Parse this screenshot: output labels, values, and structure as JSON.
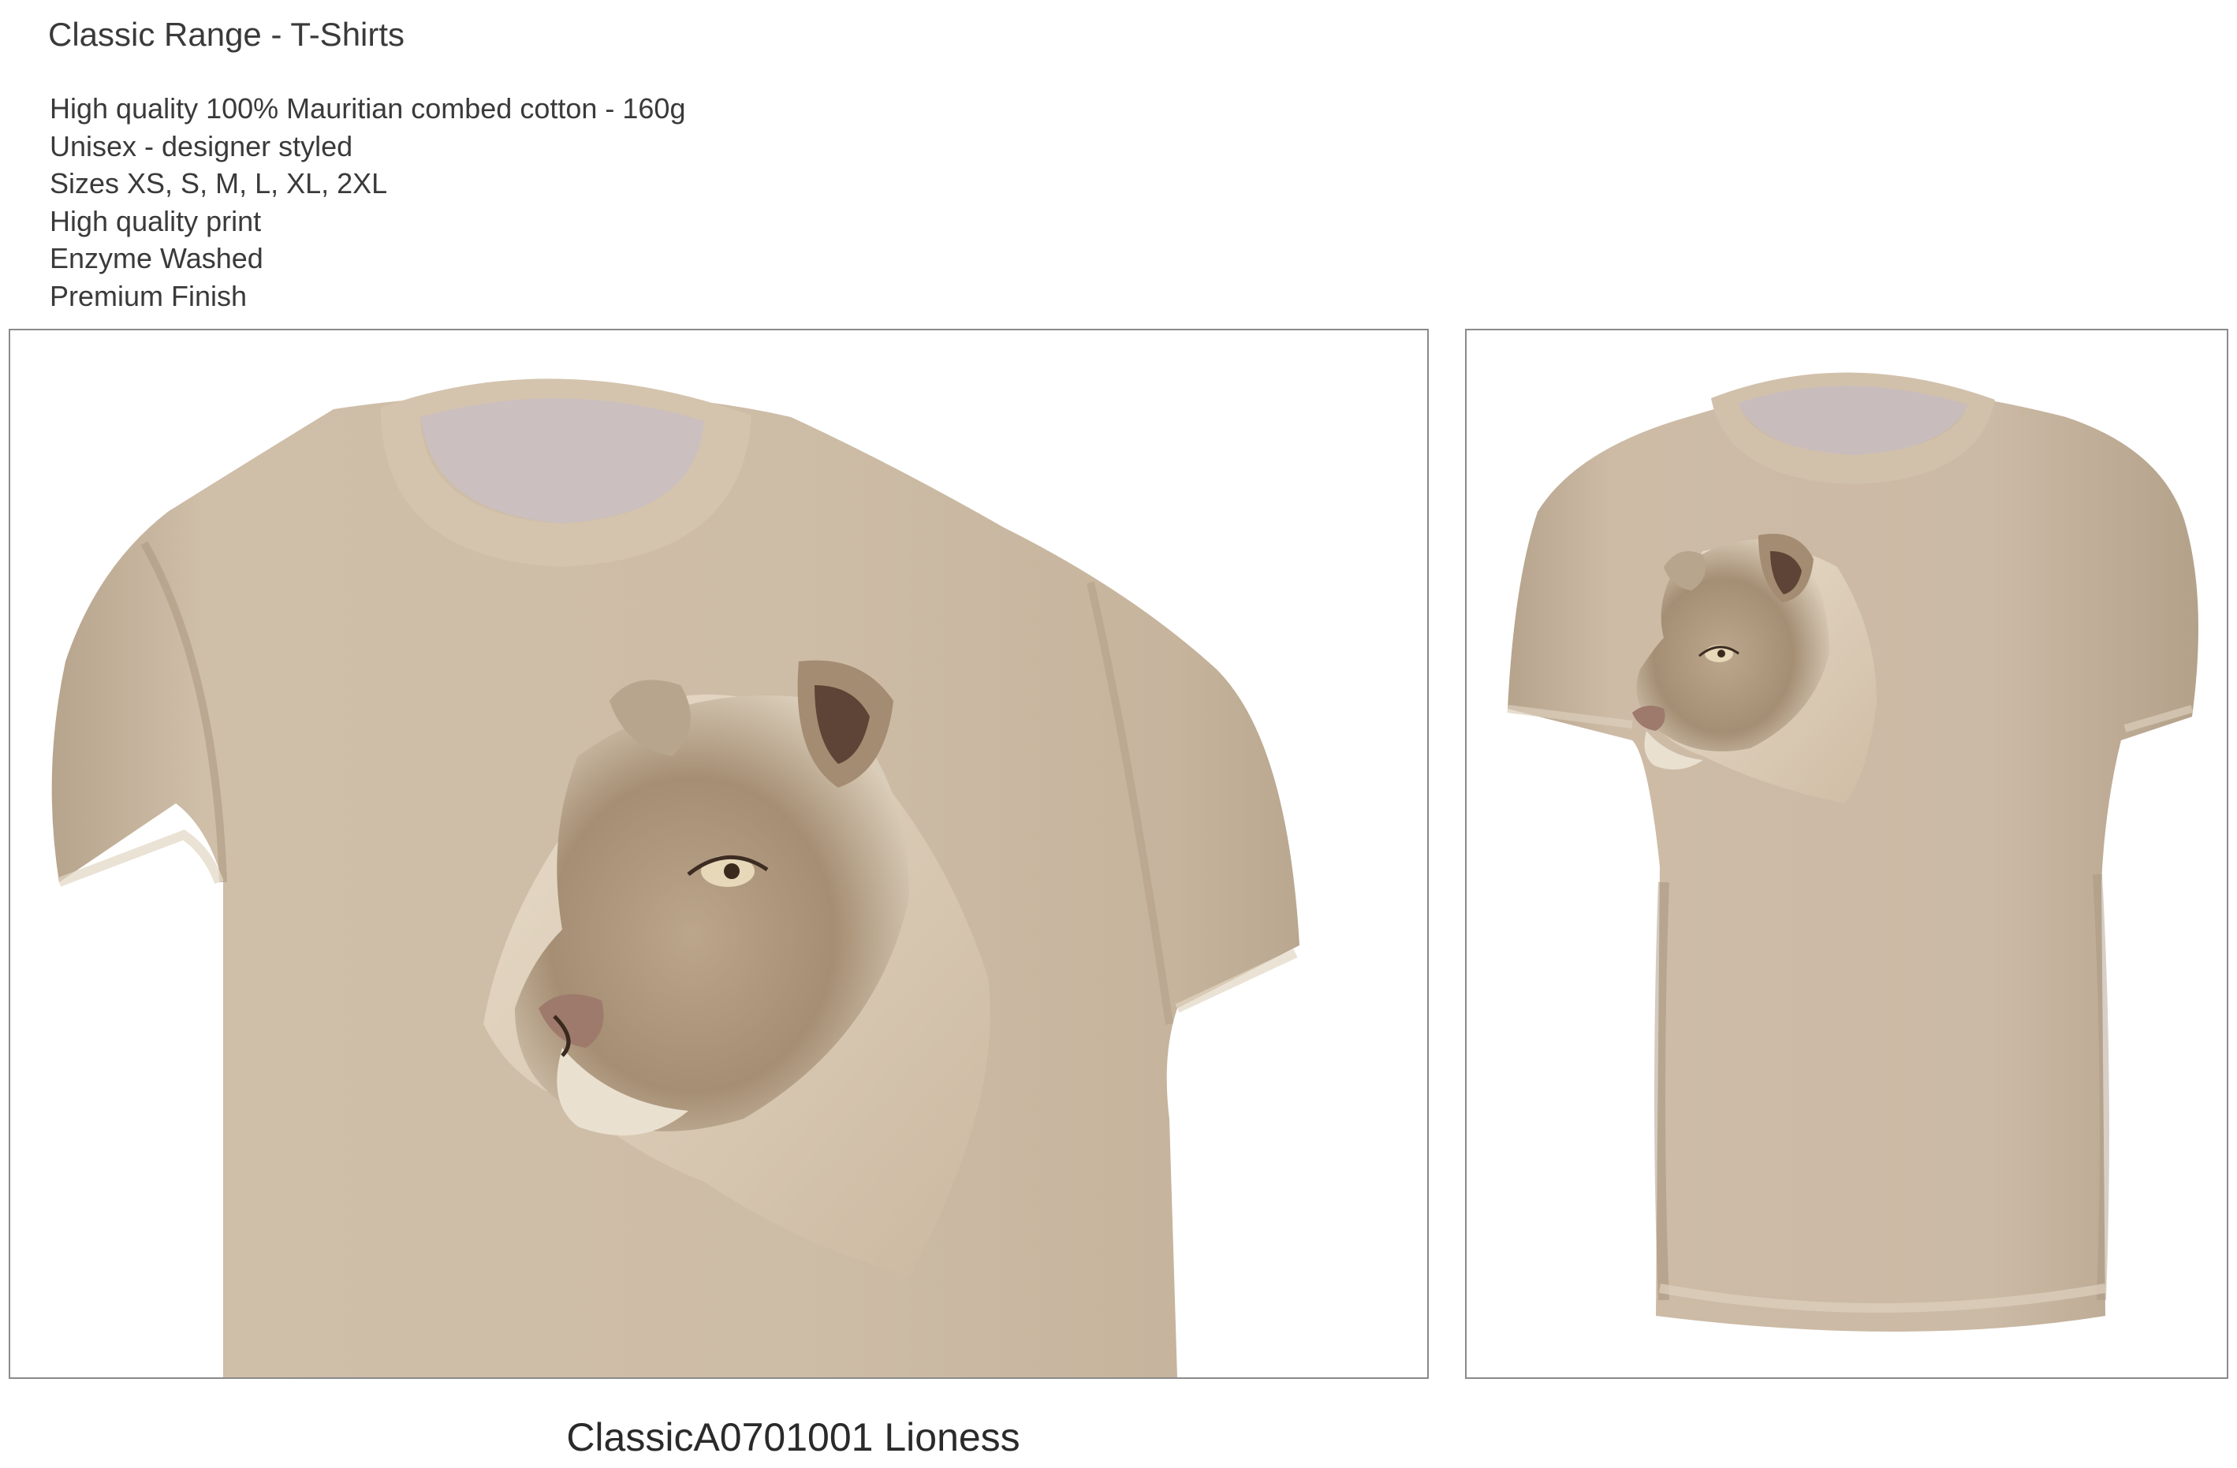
{
  "header": {
    "title": "Classic Range - T-Shirts"
  },
  "features": [
    "High quality 100% Mauritian combed cotton - 160g",
    "Unisex - designer styled",
    "Sizes XS, S, M, L, XL, 2XL",
    "High quality print",
    "Enzyme Washed",
    "Premium Finish"
  ],
  "images": {
    "closeup_icon": "tshirt-closeup-lioness-print",
    "full_icon": "tshirt-full-lioness-print"
  },
  "product": {
    "code_label": "ClassicA0701001 Lioness"
  },
  "colors": {
    "shirt": "#cbb9a2",
    "shirt_shadow": "#a8967f",
    "collar_inner": "#c9bcbc",
    "frame_border": "#8a8a8a",
    "text": "#3a3a3a"
  }
}
